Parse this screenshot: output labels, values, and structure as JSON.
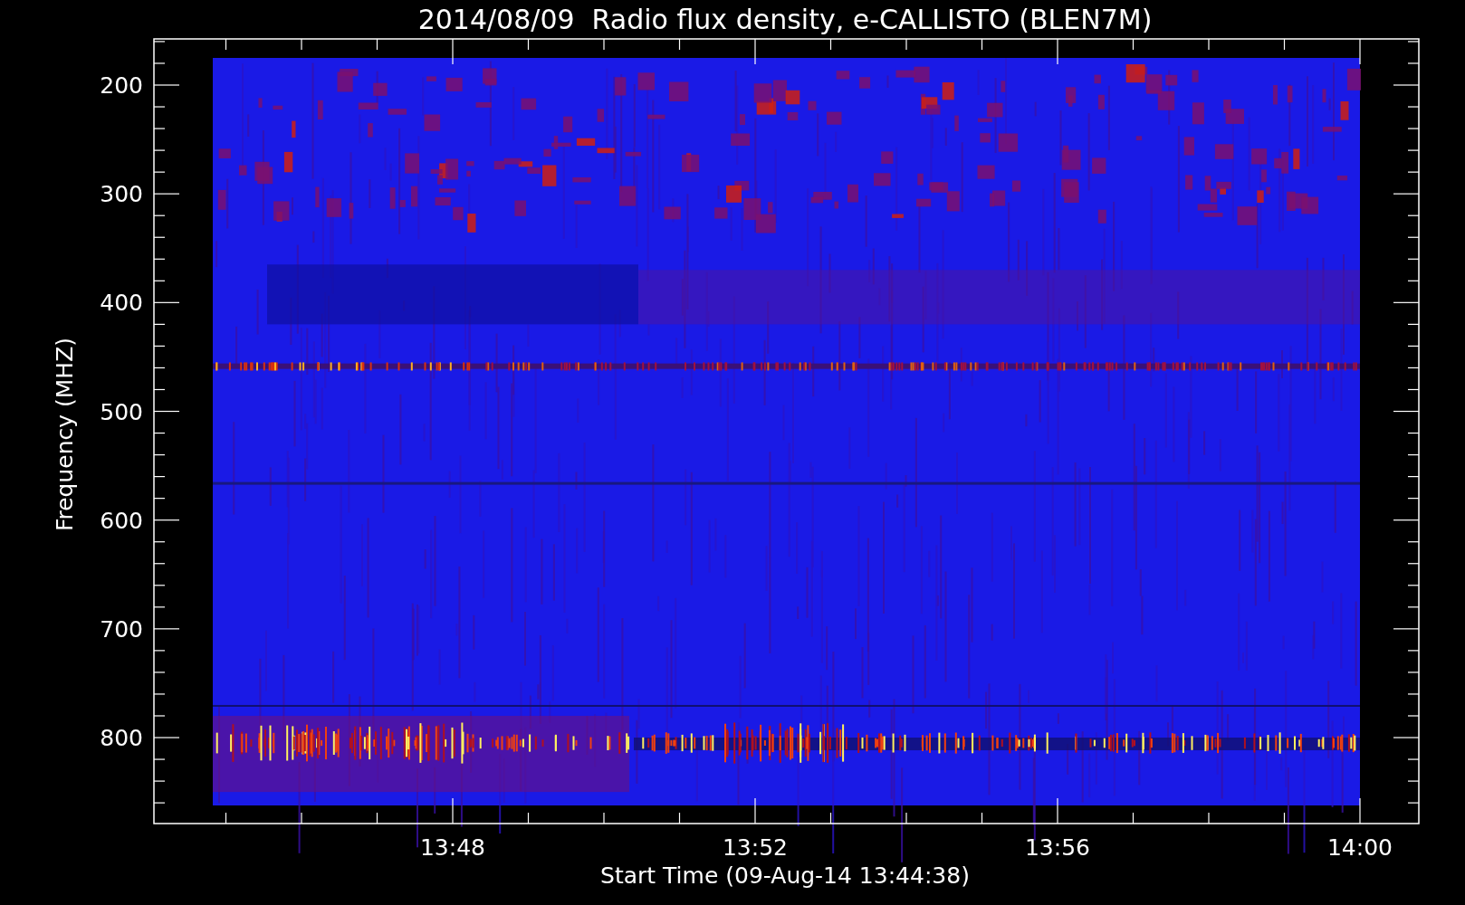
{
  "title": "2014/08/09  Radio flux density, e-CALLISTO (BLEN7M)",
  "y_axis": {
    "label": "Frequency (MHZ)",
    "ticks": [
      "200",
      "300",
      "400",
      "500",
      "600",
      "700",
      "800"
    ]
  },
  "x_axis": {
    "label": "Start Time (09-Aug-14 13:44:38)",
    "ticks": [
      "13:48",
      "13:52",
      "13:56",
      "14:00"
    ]
  }
}
